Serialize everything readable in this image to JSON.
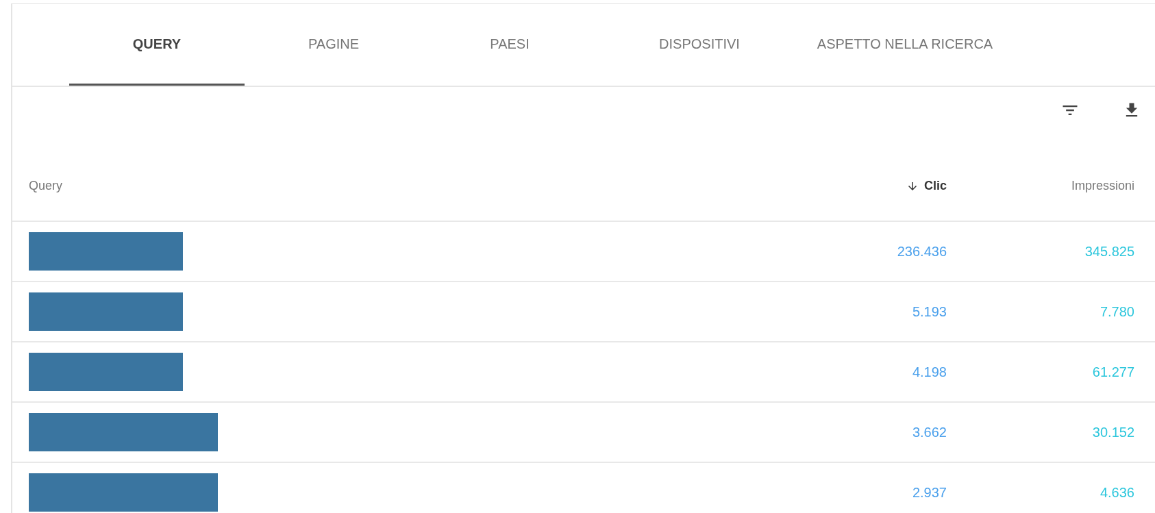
{
  "tabs": [
    {
      "label": "QUERY",
      "selected": true
    },
    {
      "label": "PAGINE",
      "selected": false
    },
    {
      "label": "PAESI",
      "selected": false
    },
    {
      "label": "DISPOSITIVI",
      "selected": false
    },
    {
      "label": "ASPETTO NELLA RICERCA",
      "selected": false
    }
  ],
  "table": {
    "columns": [
      {
        "label": "Query",
        "sorted": false
      },
      {
        "label": "Clic",
        "sorted": true
      },
      {
        "label": "Impressioni",
        "sorted": false
      }
    ],
    "rows": [
      {
        "kind": "short",
        "clic": "236.436",
        "impressioni": "345.825"
      },
      {
        "kind": "short",
        "clic": "5.193",
        "impressioni": "7.780"
      },
      {
        "kind": "short",
        "clic": "4.198",
        "impressioni": "61.277"
      },
      {
        "kind": "long",
        "clic": "3.662",
        "impressioni": "30.152"
      },
      {
        "kind": "long",
        "clic": "2.937",
        "impressioni": "4.636"
      }
    ]
  }
}
